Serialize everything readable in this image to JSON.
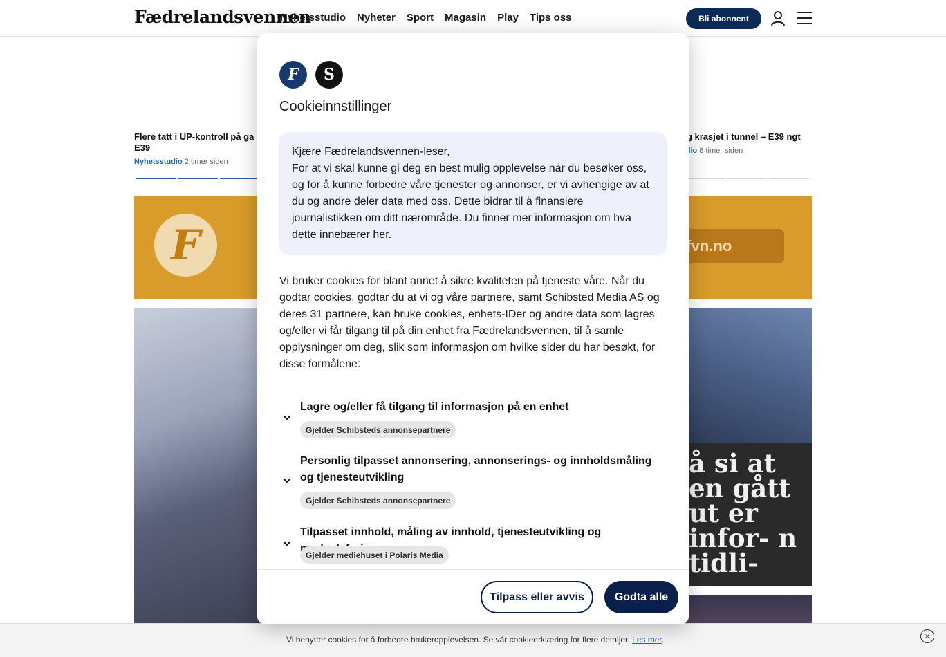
{
  "header": {
    "logo": "Fædrelandsvennen",
    "nav": [
      "Nyhetsstudio",
      "Nyheter",
      "Sport",
      "Magasin",
      "Play",
      "Tips oss"
    ],
    "subscribe_label": "Bli abonnent"
  },
  "teasers": {
    "left": {
      "title": "Flere tatt i UP-kontroll på ga E39",
      "source": "Nyhetsstudio",
      "time": "2 timer siden"
    },
    "right": {
      "title": "og krasjet i tunnel – E39 ngt",
      "source": "udio",
      "time": "8 timer siden"
    }
  },
  "promo": {
    "logo_letter": "F",
    "button_text": "v fvn.no"
  },
  "article_overlay_text": "å si at en gått ut er infor- n tidli-",
  "modal": {
    "title": "Cookieinnstillinger",
    "greeting_line1": "Kjære Fædrelandsvennen-leser,",
    "greeting_body": "For at vi skal kunne gi deg en best mulig opplevelse når du besøker oss, og for å kunne forbedre våre tjenester og annonser, er vi avhengige av at du og andre deler data med oss. Dette bidrar til å finansiere journalistikken om ditt nærområde. Du finner mer informasjon om hva dette innebærer her.",
    "body": "Vi bruker cookies for blant annet å sikre kvaliteten på tjeneste våre. Når du godtar cookies, godtar du at vi og våre partnere, samt Schibsted Media AS og deres 31 partnere, kan bruke cookies, enhets-IDer og andre data som lagres og/eller vi får tilgang til på din enhet fra Fædrelandsvennen, til å samle opplysninger om deg, slik som informasjon om hvilke sider du har besøkt, for disse formålene:",
    "purposes": [
      {
        "title": "Lagre og/eller få tilgang til informasjon på en enhet",
        "tag": "Gjelder Schibsteds annonsepartnere"
      },
      {
        "title": "Personlig tilpasset annonsering, annonserings- og innholdsmåling og tjenesteutvikling",
        "tag": "Gjelder Schibsteds annonsepartnere"
      },
      {
        "title": "Tilpasset innhold, måling av innhold, tjenesteutvikling og markedsføring",
        "tag": "Gjelder mediehuset i Polaris Media"
      }
    ],
    "customize_label": "Tilpass eller avvis",
    "accept_label": "Godta alle"
  },
  "bottom_banner": {
    "text": "Vi benytter cookies for å forbedre brukeropplevelsen. Se vår cookieerklæring for flere detaljer.",
    "link": "Les mer",
    "suffix": ".",
    "close_glyph": "×"
  },
  "colors": {
    "brand_navy": "#0b1f4d",
    "header_button": "#0b2a56",
    "promo": "#d99b2a",
    "greeting_bg": "#eef1fb"
  }
}
